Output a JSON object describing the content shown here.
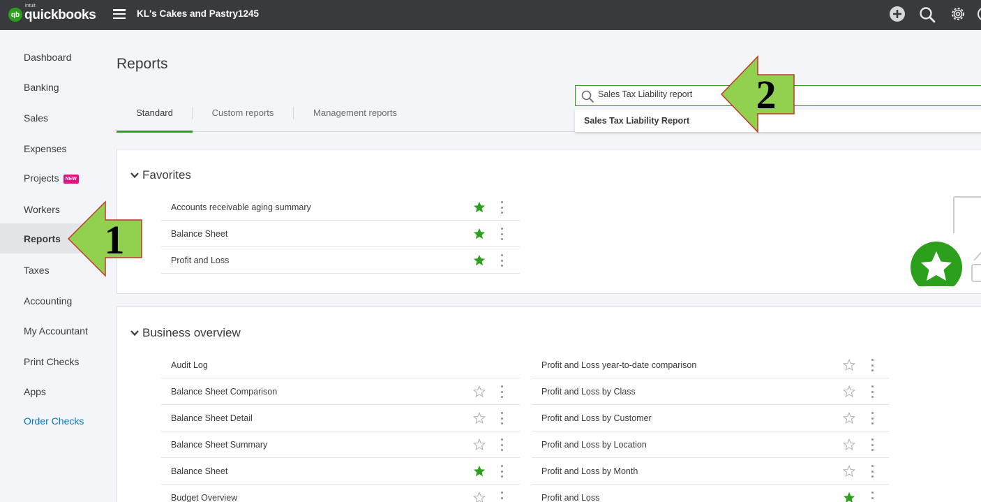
{
  "header": {
    "logo_badge": "qb",
    "logo_intuit": "intuit",
    "logo_word": "quickbooks",
    "company_name": "KL's Cakes and Pastry1245",
    "icons": [
      "plus-circle-icon",
      "search-icon",
      "gear-icon",
      "help-icon"
    ],
    "bar_color": "#393a3d"
  },
  "sidebar": {
    "items": [
      {
        "label": "Dashboard"
      },
      {
        "label": "Banking"
      },
      {
        "label": "Sales"
      },
      {
        "label": "Expenses"
      },
      {
        "label": "Projects",
        "badge": "NEW"
      },
      {
        "label": "Workers"
      },
      {
        "label": "Reports",
        "active": true
      },
      {
        "label": "Taxes"
      },
      {
        "label": "Accounting"
      },
      {
        "label": "My Accountant"
      },
      {
        "label": "Print Checks"
      },
      {
        "label": "Apps"
      },
      {
        "label": "Order Checks",
        "link": true
      }
    ]
  },
  "main": {
    "title": "Reports",
    "tabs": [
      {
        "label": "Standard",
        "active": true
      },
      {
        "label": "Custom reports"
      },
      {
        "label": "Management reports"
      }
    ],
    "search": {
      "value": "Sales Tax Liability report",
      "suggestion": "Sales Tax Liability Report"
    },
    "favorites": {
      "title": "Favorites",
      "rows": [
        {
          "label": "Accounts receivable aging summary",
          "starred": true
        },
        {
          "label": "Balance Sheet",
          "starred": true
        },
        {
          "label": "Profit and Loss",
          "starred": true
        }
      ]
    },
    "business_overview": {
      "title": "Business overview",
      "left_rows": [
        {
          "label": "Audit Log",
          "starred": null
        },
        {
          "label": "Balance Sheet Comparison",
          "starred": false
        },
        {
          "label": "Balance Sheet Detail",
          "starred": false
        },
        {
          "label": "Balance Sheet Summary",
          "starred": false
        },
        {
          "label": "Balance Sheet",
          "starred": true
        },
        {
          "label": "Budget Overview",
          "starred": false
        }
      ],
      "right_rows": [
        {
          "label": "Profit and Loss year-to-date comparison",
          "starred": false
        },
        {
          "label": "Profit and Loss by Class",
          "starred": false
        },
        {
          "label": "Profit and Loss by Customer",
          "starred": false
        },
        {
          "label": "Profit and Loss by Location",
          "starred": false
        },
        {
          "label": "Profit and Loss by Month",
          "starred": false
        },
        {
          "label": "Profit and Loss",
          "starred": true
        }
      ]
    }
  },
  "annotations": {
    "arrow1_label": "1",
    "arrow2_label": "2",
    "arrow_color": "#92d050",
    "arrow_border": "#c0392b"
  },
  "colors": {
    "accent": "#2ca01c",
    "link": "#0077c5",
    "new_badge": "#e0127f"
  }
}
